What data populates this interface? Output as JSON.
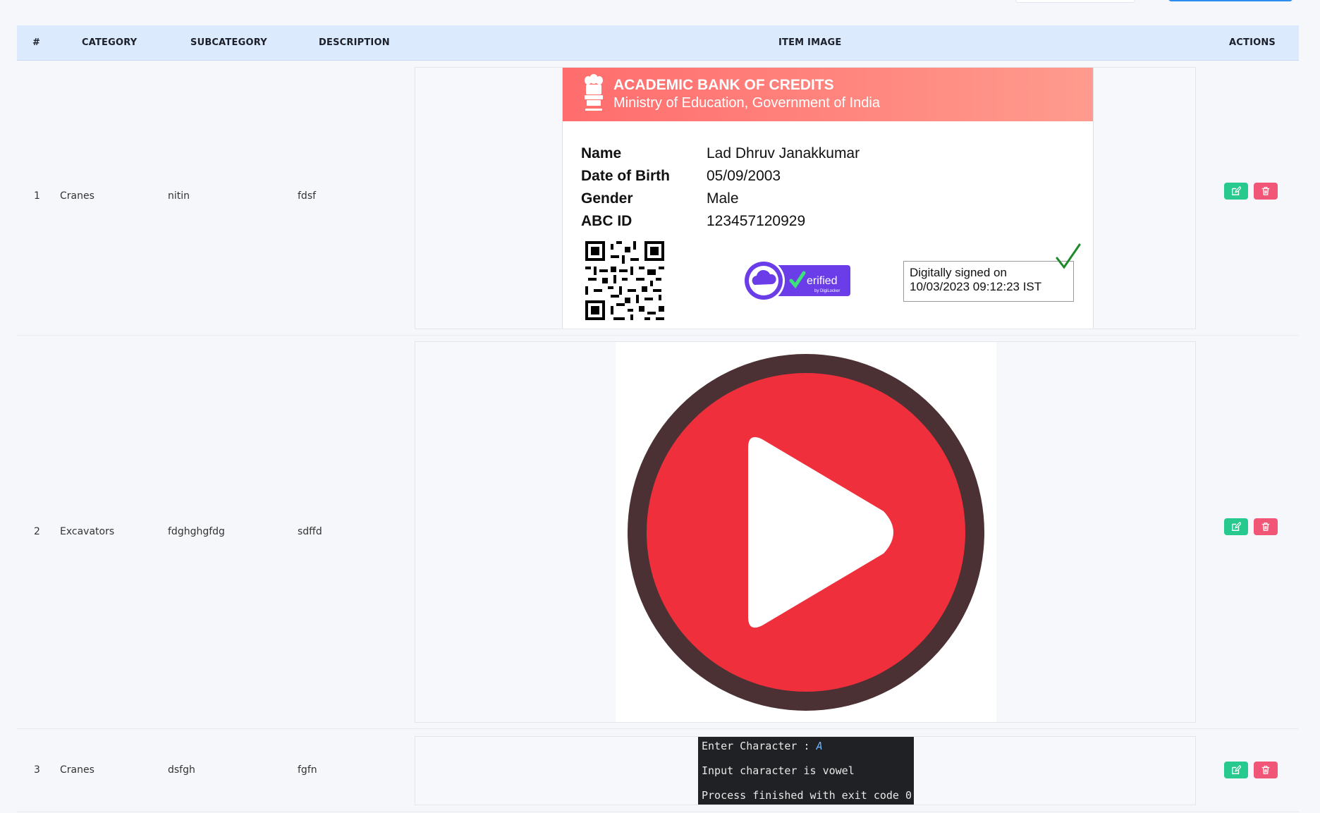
{
  "table": {
    "headers": {
      "index": "#",
      "category": "CATEGORY",
      "subcategory": "SUBCATEGORY",
      "description": "DESCRIPTION",
      "item_image": "ITEM IMAGE",
      "actions": "ACTIONS"
    },
    "rows": [
      {
        "index": "1",
        "category": "Cranes",
        "subcategory": "nitin",
        "description": "fdsf"
      },
      {
        "index": "2",
        "category": "Excavators",
        "subcategory": "fdghghgfdg",
        "description": "sdffd"
      },
      {
        "index": "3",
        "category": "Cranes",
        "subcategory": "dsfgh",
        "description": "fgfn"
      }
    ],
    "action_icons": {
      "edit": "edit-icon",
      "delete": "trash-icon"
    }
  },
  "abc_card": {
    "title": "ACADEMIC BANK OF CREDITS",
    "subtitle": "Ministry of Education, Government of India",
    "fields": [
      {
        "label": "Name",
        "value": "Lad Dhruv Janakkumar"
      },
      {
        "label": "Date of Birth",
        "value": "05/09/2003"
      },
      {
        "label": "Gender",
        "value": "Male"
      },
      {
        "label": "ABC ID",
        "value": "123457120929"
      }
    ],
    "verified_text": "erified",
    "verified_sub": "by DigiLocker",
    "signed_line1": "Digitally signed on",
    "signed_line2": "10/03/2023 09:12:23 IST"
  },
  "terminal": {
    "prompt": "Enter Character : ",
    "input": "A",
    "line2": "Input character is vowel",
    "line3": "Process finished with exit code 0"
  },
  "colors": {
    "header_bg": "#dbeafd",
    "edit": "#27c98f",
    "delete": "#f25676",
    "play_red": "#ef2f3c",
    "play_ring": "#4b3133",
    "card_head": "#ff7a74"
  }
}
